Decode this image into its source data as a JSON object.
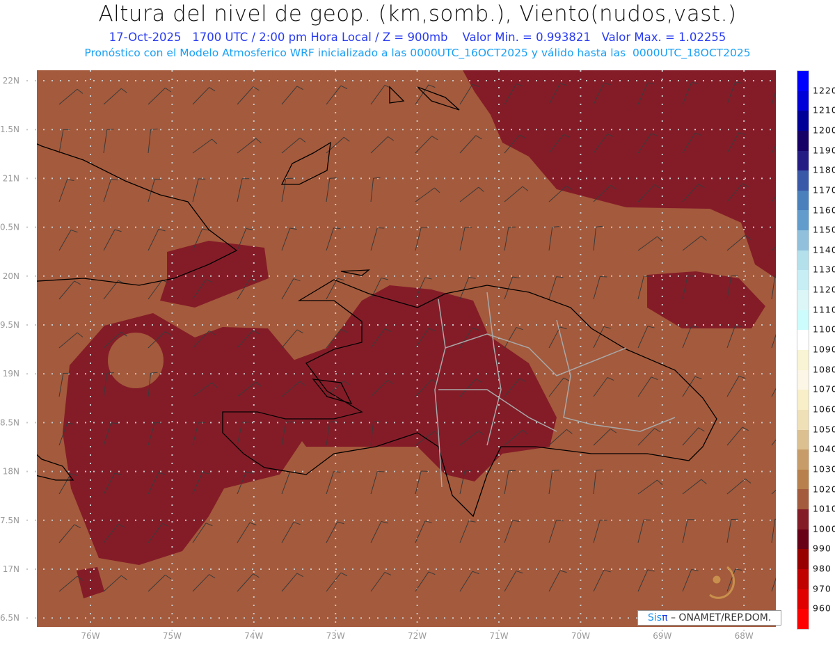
{
  "header": {
    "title": "Altura del nivel de geop. (km,somb.), Viento(nudos,vast.)",
    "info_line": "17-Oct-2025   1700 UTC / 2:00 pm Hora Local / Z = 900mb    Valor Min. = 0.993821   Valor Max. = 1.02255",
    "model_line": "Pronóstico con el Modelo Atmosferico WRF inicializado a las 0000UTC_16OCT2025 y válido hasta las  0000UTC_18OCT2025"
  },
  "map": {
    "lat_labels": [
      "22N",
      "1.5N",
      "21N",
      "0.5N",
      "20N",
      "9.5N",
      "19N",
      "8.5N",
      "18N",
      "7.5N",
      "17N",
      "6.5N"
    ],
    "lon_labels": [
      "76W",
      "75W",
      "74W",
      "73W",
      "72W",
      "71W",
      "70W",
      "69W",
      "68W"
    ],
    "colors": {
      "background": "#a45a3c",
      "low": "#841c28",
      "coast": "#000000",
      "borders": "#a8a8a8",
      "grid": "#c8c8c8"
    }
  },
  "colorbar": {
    "labels": [
      "1220",
      "1210",
      "1200",
      "1190",
      "1180",
      "1170",
      "1160",
      "1150",
      "1140",
      "1130",
      "1120",
      "1110",
      "1100",
      "1090",
      "1080",
      "1070",
      "1060",
      "1050",
      "1040",
      "1030",
      "1020",
      "1010",
      "1000",
      "990",
      "980",
      "970",
      "960"
    ],
    "colors": [
      "#0000ff",
      "#0000d8",
      "#000098",
      "#160068",
      "#241c84",
      "#3a58a8",
      "#4a80bc",
      "#629ccc",
      "#90c0dc",
      "#b4e0ec",
      "#c6eef4",
      "#dcf6f8",
      "#ccfcfc",
      "#ffffff",
      "#f8f4d4",
      "#fcf6e6",
      "#f8eec8",
      "#f0e0b8",
      "#dcc090",
      "#c89c68",
      "#b8804c",
      "#a45a3c",
      "#841c28",
      "#680018",
      "#980000",
      "#c00000",
      "#e00000",
      "#ff0000"
    ]
  },
  "credit": {
    "sis": "Sis",
    "pi": "π",
    "text": "– ONAMET/REP.DOM."
  }
}
